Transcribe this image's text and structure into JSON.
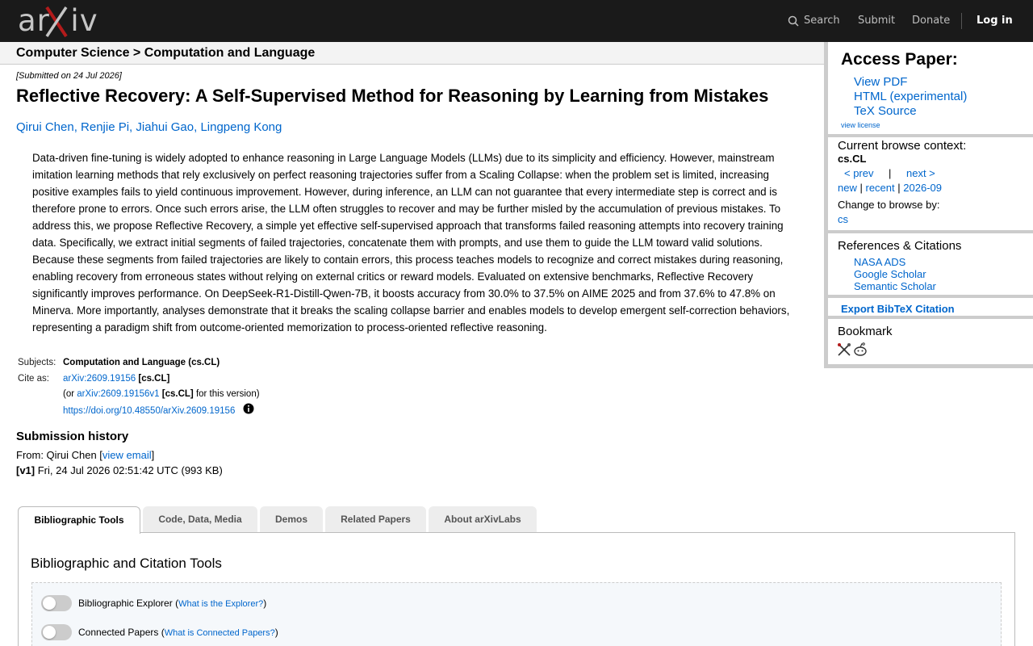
{
  "header": {
    "logo_text": "arXiv",
    "search": "Search",
    "submit": "Submit",
    "donate": "Donate",
    "login": "Log in"
  },
  "breadcrumb": "Computer Science > Computation and Language",
  "paper": {
    "submitted": "[Submitted on 24 Jul 2026]",
    "title": "Reflective Recovery: A Self-Supervised Method for Reasoning by Learning from Mistakes",
    "authors": "Qirui Chen, Renjie Pi, Jiahui Gao, Lingpeng Kong",
    "abstract": "Data-driven fine-tuning is widely adopted to enhance reasoning in Large Language Models (LLMs) due to its simplicity and efficiency. However, mainstream imitation learning methods that rely exclusively on perfect reasoning trajectories suffer from a Scaling Collapse: when the problem set is limited, increasing positive examples fails to yield continuous improvement. However, during inference, an LLM can not guarantee that every intermediate step is correct and is therefore prone to errors. Once such errors arise, the LLM often struggles to recover and may be further misled by the accumulation of previous mistakes. To address this, we propose Reflective Recovery, a simple yet effective self-supervised approach that transforms failed reasoning attempts into recovery training data. Specifically, we extract initial segments of failed trajectories, concatenate them with prompts, and use them to guide the LLM toward valid solutions. Because these segments from failed trajectories are likely to contain errors, this process teaches models to recognize and correct mistakes during reasoning, enabling recovery from erroneous states without relying on external critics or reward models. Evaluated on extensive benchmarks, Reflective Recovery significantly improves performance. On DeepSeek-R1-Distill-Qwen-7B, it boosts accuracy from 30.0% to 37.5% on AIME 2025 and from 37.6% to 47.8% on Minerva. More importantly, analyses demonstrate that it breaks the scaling collapse barrier and enables models to develop emergent self-correction behaviors, representing a paradigm shift from outcome-oriented memorization to process-oriented reflective reasoning."
  },
  "meta": {
    "subjects_label": "Subjects:",
    "subjects_value": "Computation and Language (cs.CL)",
    "cite_label": "Cite as:",
    "cite_id": "arXiv:2609.19156",
    "cite_cat": "[cs.CL]",
    "or_prefix": "(or ",
    "cite_v1": "arXiv:2609.19156v1",
    "cite_v1_cat": "[cs.CL]",
    "or_suffix": " for this version)",
    "doi": "https://doi.org/10.48550/arXiv.2609.19156"
  },
  "history": {
    "title": "Submission history",
    "from_prefix": "From: Qirui Chen [",
    "view_email": "view email",
    "from_suffix": "]",
    "v1_label": "[v1]",
    "v1_value": " Fri, 24 Jul 2026 02:51:42 UTC (993 KB)"
  },
  "sidebar": {
    "access_title": "Access Paper:",
    "view_pdf": "View PDF",
    "html": "HTML (experimental)",
    "tex": "TeX Source",
    "view_license": "view license",
    "context_title": "Current browse context:",
    "context_cat": "cs.CL",
    "prev": "< prev",
    "sep": "|",
    "next": "next >",
    "new": "new",
    "recent": "recent",
    "month": "2026-09",
    "change_by": "Change to browse by:",
    "cs": "cs",
    "refs_title": "References & Citations",
    "nasa": "NASA ADS",
    "scholar": "Google Scholar",
    "semantic": "Semantic Scholar",
    "bibtex": "Export BibTeX Citation",
    "bookmark_title": "Bookmark"
  },
  "tabs": [
    {
      "label": "Bibliographic Tools"
    },
    {
      "label": "Code, Data, Media"
    },
    {
      "label": "Demos"
    },
    {
      "label": "Related Papers"
    },
    {
      "label": "About arXivLabs"
    }
  ],
  "panel": {
    "title": "Bibliographic and Citation Tools",
    "tool1_label": "Bibliographic Explorer",
    "tool1_link": "What is the Explorer?",
    "tool2_label": "Connected Papers",
    "tool2_link": "What is Connected Papers?",
    "open_paren": " (",
    "close_paren": ")"
  },
  "colors": {
    "topbar": "#1a1a1a",
    "link": "#0066cc",
    "logo_x": "#b31b1b"
  }
}
